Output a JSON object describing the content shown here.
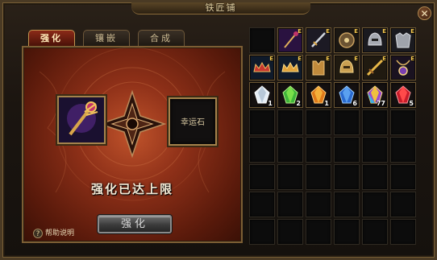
{
  "window": {
    "title": "铁匠铺",
    "close_glyph": "✕"
  },
  "tabs": [
    {
      "label": "强化",
      "active": true
    },
    {
      "label": "镶嵌",
      "active": false
    },
    {
      "label": "合成",
      "active": false
    }
  ],
  "enhance": {
    "lucky_stone_label": "幸运石",
    "status_text": "强化已达上限",
    "button_label": "强化",
    "help_label": "帮助说明",
    "help_icon_glyph": "?"
  },
  "inventory": {
    "columns": 6,
    "rows": 8,
    "items": [
      {
        "slot": 0,
        "icon": "empty-slot",
        "tier": "",
        "count": ""
      },
      {
        "slot": 1,
        "icon": "magic-staff-icon",
        "tier": "E",
        "count": ""
      },
      {
        "slot": 2,
        "icon": "sword-icon",
        "tier": "E",
        "count": ""
      },
      {
        "slot": 3,
        "icon": "shield-orb-icon",
        "tier": "E",
        "count": ""
      },
      {
        "slot": 4,
        "icon": "helmet-icon",
        "tier": "E",
        "count": ""
      },
      {
        "slot": 5,
        "icon": "armor-icon",
        "tier": "E",
        "count": ""
      },
      {
        "slot": 6,
        "icon": "crown-red-icon",
        "tier": "E",
        "count": ""
      },
      {
        "slot": 7,
        "icon": "crown-gold-icon",
        "tier": "E",
        "count": ""
      },
      {
        "slot": 8,
        "icon": "vest-icon",
        "tier": "E",
        "count": ""
      },
      {
        "slot": 9,
        "icon": "golden-helmet-icon",
        "tier": "E",
        "count": ""
      },
      {
        "slot": 10,
        "icon": "golden-sword-icon",
        "tier": "E",
        "count": ""
      },
      {
        "slot": 11,
        "icon": "amulet-icon",
        "tier": "E",
        "count": ""
      },
      {
        "slot": 12,
        "icon": "white-gem-icon",
        "tier": "",
        "count": "1"
      },
      {
        "slot": 13,
        "icon": "green-gem-icon",
        "tier": "",
        "count": "2"
      },
      {
        "slot": 14,
        "icon": "orange-gem-icon",
        "tier": "",
        "count": "1"
      },
      {
        "slot": 15,
        "icon": "blue-gem-icon",
        "tier": "",
        "count": "6"
      },
      {
        "slot": 16,
        "icon": "rainbow-gem-icon",
        "tier": "",
        "count": "77"
      },
      {
        "slot": 17,
        "icon": "red-gem-icon",
        "tier": "",
        "count": "5"
      }
    ]
  },
  "colors": {
    "accent_gold": "#c0944f",
    "active_tab": "#8b2a18",
    "panel_red": "#8e3018",
    "tier_yellow": "#f5c84d"
  }
}
